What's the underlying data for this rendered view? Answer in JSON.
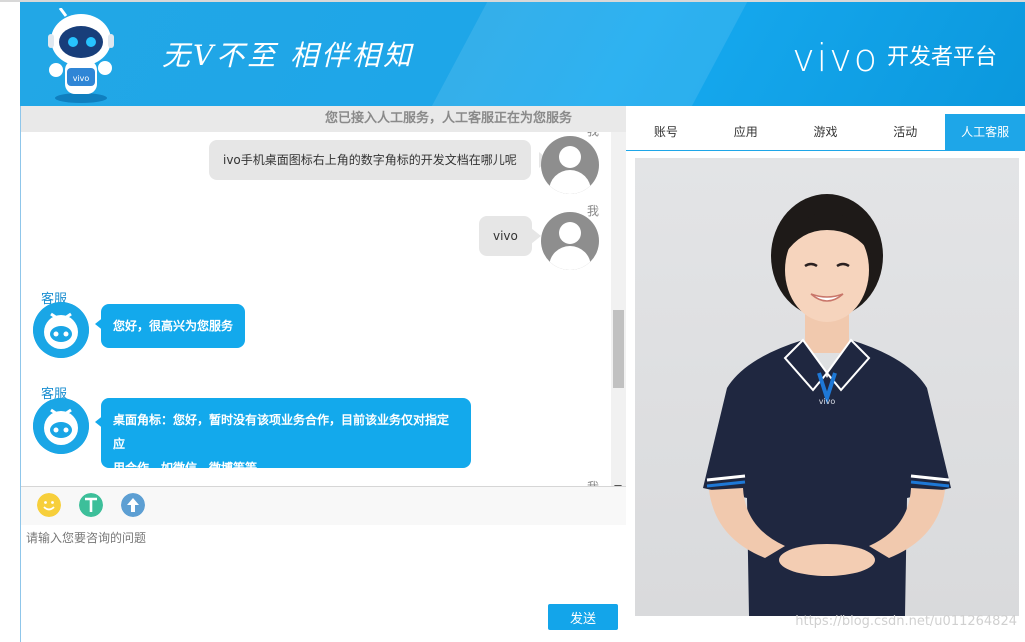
{
  "header": {
    "slogan": "无V不至  相伴相知",
    "brand_logo": "vivo",
    "brand_sub": "开发者平台",
    "mascot_label": "vivo"
  },
  "chat": {
    "status": "您已接入人工服务，人工客服正在为您服务",
    "messages": [
      {
        "from": "user",
        "sender": "我",
        "text": "ivo手机桌面图标右上角的数字角标的开发文档在哪儿呢"
      },
      {
        "from": "user",
        "sender": "我",
        "text": "vivo"
      },
      {
        "from": "agent",
        "sender": "客服",
        "text": "您好，很高兴为您服务"
      },
      {
        "from": "agent",
        "sender": "客服",
        "lines": [
          "桌面角标：您好，暂时没有该项业务合作，目前该业务仅对指定应",
          "用合作，如微信，微博等等"
        ]
      }
    ],
    "trailing_sender": "我",
    "toolbar": [
      "emoji-icon",
      "text-format-icon",
      "upload-icon"
    ],
    "input_placeholder": "请输入您要咨询的问题",
    "send_label": "发送"
  },
  "right_panel": {
    "tabs": [
      {
        "label": "账号",
        "active": false
      },
      {
        "label": "应用",
        "active": false
      },
      {
        "label": "游戏",
        "active": false
      },
      {
        "label": "活动",
        "active": false
      },
      {
        "label": "人工客服",
        "active": true
      }
    ],
    "shirt_logo": "vivo"
  },
  "watermark": "https://blog.csdn.net/u011264824",
  "colors": {
    "brand_blue": "#1ea6e8",
    "agent_bubble": "#13a9ec",
    "user_bubble": "#e6e6e6"
  }
}
